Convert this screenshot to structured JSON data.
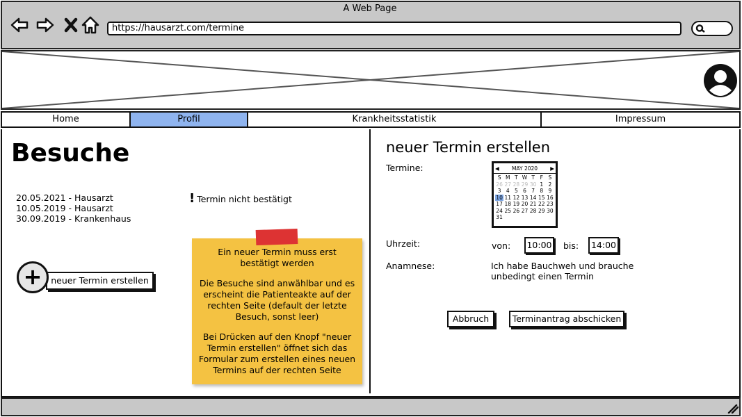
{
  "window": {
    "title": "A Web Page",
    "url": "https://hausarzt.com/termine"
  },
  "nav": {
    "tabs": [
      {
        "label": "Home"
      },
      {
        "label": "Profil"
      },
      {
        "label": "Krankheitsstatistik"
      },
      {
        "label": "Impressum"
      }
    ]
  },
  "colors": {
    "active_tab": "#8fb4ef",
    "note": "#f4c242",
    "tape": "#dd3333",
    "chrome": "#c8c8c8"
  },
  "left": {
    "title": "Besuche",
    "visits": [
      "20.05.2021 - Hausarzt",
      "10.05.2019 - Hausarzt",
      "30.09.2019 - Krankenhaus"
    ],
    "warning_icon": "!",
    "warning_text": "Termin nicht bestätigt",
    "new_button_label": "neuer Termin erstellen",
    "note": [
      "Ein neuer Termin muss erst bestätigt werden",
      "Die Besuche sind anwählbar und es erscheint die Patienteakte auf der rechten Seite (default der letzte Besuch, sonst leer)",
      "Bei Drücken auf den Knopf \"neuer Termin erstellen\" öffnet sich das Formular zum erstellen eines neuen Termins auf der rechten Seite"
    ]
  },
  "right": {
    "title": "neuer Termin erstellen",
    "termine_label": "Termine:",
    "calendar": {
      "month": "MAY 2020",
      "weekdays": [
        "S",
        "M",
        "T",
        "W",
        "T",
        "F",
        "S"
      ],
      "days": [
        "26",
        "27",
        "28",
        "29",
        "30",
        "1",
        "2",
        "3",
        "4",
        "5",
        "6",
        "7",
        "8",
        "9",
        "10",
        "11",
        "12",
        "13",
        "14",
        "15",
        "16",
        "17",
        "18",
        "19",
        "20",
        "21",
        "22",
        "23",
        "24",
        "25",
        "26",
        "27",
        "28",
        "29",
        "30",
        "31"
      ],
      "selected_day": "10"
    },
    "uhrzeit_label": "Uhrzeit:",
    "von_label": "von:",
    "von_value": "10:00",
    "bis_label": "bis:",
    "bis_value": "14:00",
    "anamnese_label": "Anamnese:",
    "anamnese_value": "Ich habe Bauchweh und brauche unbedingt einen Termin",
    "cancel_label": "Abbruch",
    "submit_label": "Terminantrag abschicken"
  }
}
